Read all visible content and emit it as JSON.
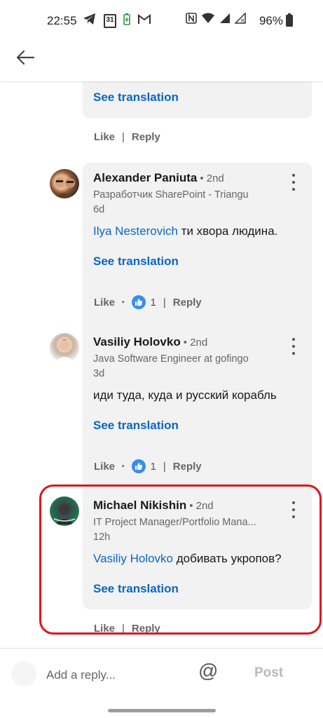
{
  "status_bar": {
    "time": "22:55",
    "calendar_day": "31",
    "battery_percent": "96%"
  },
  "header": {
    "back_icon": "arrow-left-icon"
  },
  "previous_comment": {
    "see_translation": "See translation",
    "like_label": "Like",
    "reply_label": "Reply"
  },
  "comments": [
    {
      "name": "Alexander Paniuta",
      "degree": "• 2nd",
      "headline": "Разработчик SharePoint - Triangu",
      "time": "6d",
      "mention": "Ilya Nesterovich",
      "text": " ти хвора людина.",
      "see_translation": "See translation",
      "like_label": "Like",
      "reaction_count": "1",
      "reply_label": "Reply"
    },
    {
      "name": "Vasiliy Holovko",
      "degree": "• 2nd",
      "headline": "Java Software Engineer at gofingo",
      "time": "3d",
      "mention": "",
      "text": "иди туда, куда и русский корабль",
      "see_translation": "See translation",
      "like_label": "Like",
      "reaction_count": "1",
      "reply_label": "Reply"
    },
    {
      "name": "Michael Nikishin",
      "degree": "• 2nd",
      "headline": "IT Project Manager/Portfolio Mana...",
      "time": "12h",
      "mention": "Vasiliy Holovko",
      "text": " добивать укропов?",
      "see_translation": "See translation",
      "like_label": "Like",
      "reply_label": "Reply"
    }
  ],
  "reply_bar": {
    "placeholder": "Add a reply...",
    "at_symbol": "@",
    "post_label": "Post"
  },
  "colors": {
    "link_blue": "#0a66c2",
    "highlight_red": "#d9181e",
    "bubble_gray": "#f2f2f2"
  }
}
